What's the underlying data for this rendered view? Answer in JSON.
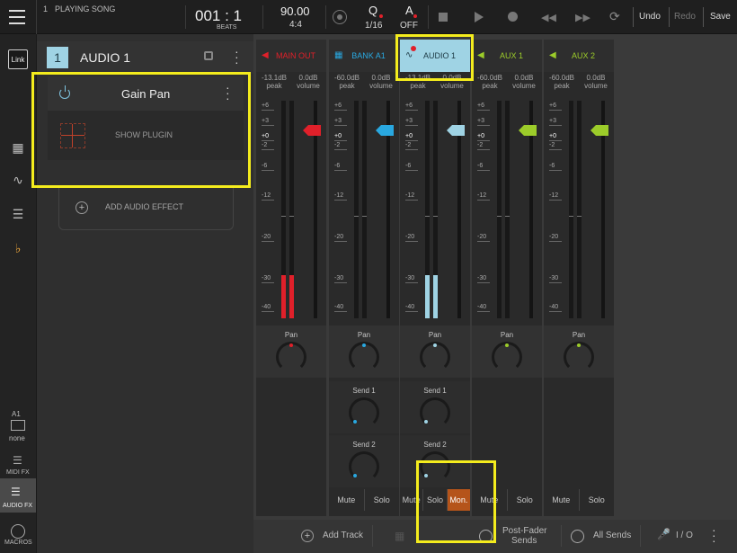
{
  "topbar": {
    "song_index": "1",
    "song_label": "PLAYING SONG",
    "position": "001 : 1",
    "position_unit": "BEATS",
    "tempo": "90.00",
    "time_sig": "4:4",
    "quantize_label": "Q",
    "quantize_value": "1/16",
    "automation_label": "A",
    "automation_value": "OFF",
    "undo_label": "Undo",
    "redo_label": "Redo",
    "save_label": "Save"
  },
  "sidebar": {
    "link_label": "Link",
    "a1_label": "A1",
    "none_label": "none",
    "midi_fx_label": "MIDI FX",
    "audio_fx_label": "AUDIO FX",
    "macros_label": "MACROS"
  },
  "left_panel": {
    "track_number": "1",
    "track_name": "AUDIO 1",
    "plugin_name": "Gain Pan",
    "show_plugin_label": "SHOW PLUGIN",
    "add_effect_label": "ADD AUDIO EFFECT"
  },
  "mixer": {
    "scale_labels": [
      "+6",
      "+3",
      "+0",
      "-2",
      "-6",
      "-12",
      "-20",
      "-30",
      "-40"
    ],
    "peak_label": "peak",
    "volume_label": "volume",
    "pan_label": "Pan",
    "send1_label": "Send 1",
    "send2_label": "Send 2",
    "mute_label": "Mute",
    "solo_label": "Solo",
    "mon_label": "Mon.",
    "channels": [
      {
        "name": "MAIN OUT",
        "peak": "-13.1dB",
        "volume": "0.0dB",
        "color": "#e0202a",
        "level": 0.2
      },
      {
        "name": "BANK A1",
        "peak": "-60.0dB",
        "volume": "0.0dB",
        "color": "#29a8e0",
        "level": 0
      },
      {
        "name": "AUDIO 1",
        "peak": "-13.1dB",
        "volume": "0.0dB",
        "color": "#9fd3e4",
        "level": 0.2
      },
      {
        "name": "AUX 1",
        "peak": "-60.0dB",
        "volume": "0.0dB",
        "color": "#9ccc2a",
        "level": 0
      },
      {
        "name": "AUX 2",
        "peak": "-60.0dB",
        "volume": "0.0dB",
        "color": "#9ccc2a",
        "level": 0
      }
    ]
  },
  "bottombar": {
    "add_track_label": "Add Track",
    "post_fader_label": "Post-Fader",
    "sends_label": "Sends",
    "all_sends_label": "All Sends",
    "io_label": "I / O"
  }
}
